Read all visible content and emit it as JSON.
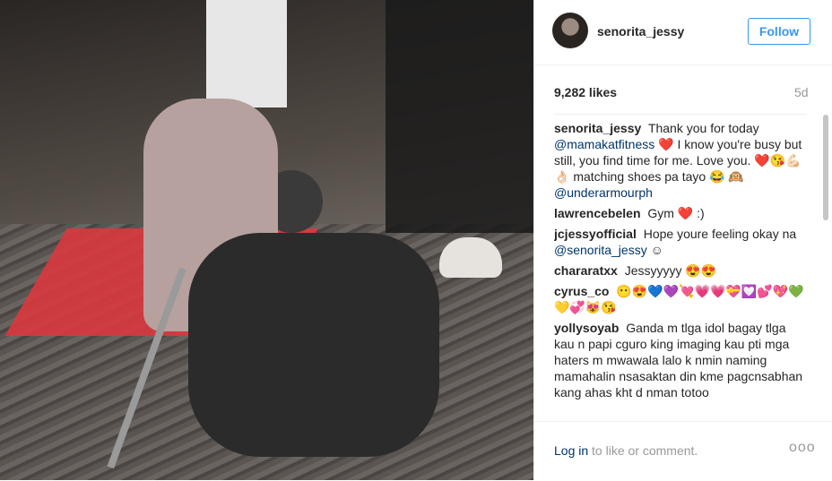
{
  "post": {
    "username": "senorita_jessy",
    "follow_label": "Follow",
    "likes": "9,282 likes",
    "age": "5d"
  },
  "comments": [
    {
      "user": "senorita_jessy",
      "text": "Thank you for today",
      "mention": "@mamakatfitness",
      "text2": "❤️ I know you're busy but still, you find time for me. Love you. ❤️😘💪🏻👌🏻 matching shoes pa tayo 😂 🙉",
      "mention2": "@underarmourph"
    },
    {
      "user": "lawrencebelen",
      "text": "Gym ❤️ :)"
    },
    {
      "user": "jcjessyofficial",
      "text": "Hope youre feeling okay na",
      "mention": "@senorita_jessy",
      "text2": "☺"
    },
    {
      "user": "chararatxx",
      "text": "Jessyyyyy 😍😍"
    },
    {
      "user": "cyrus_co",
      "text": "😶😍💙💜💘💗💗💝💟💕💖💚💛💞😻😘"
    },
    {
      "user": "yollysoyab",
      "text": "Ganda m tlga idol bagay tlga kau n papi cguro king imaging kau pti mga haters m mwawala lalo k nmin naming mamahalin nsasaktan din kme pagcnsabhan kang ahas kht d nman totoo"
    }
  ],
  "footer": {
    "login_label": "Log in",
    "login_suffix": " to like or comment.",
    "more_label": "ooo"
  }
}
